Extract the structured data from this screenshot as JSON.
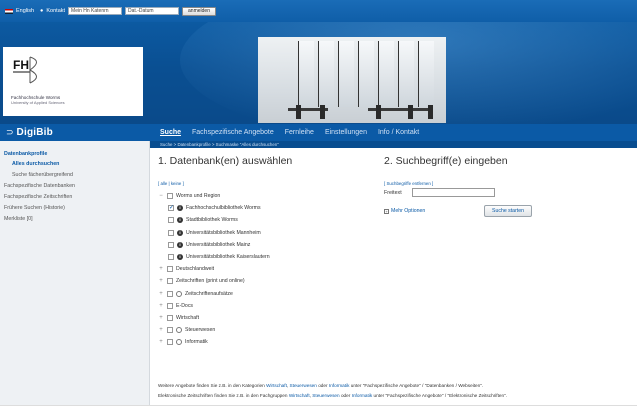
{
  "topbar": {
    "lang_label": "English",
    "contact_label": "Kontakt",
    "input1_value": "Mein Hn Katenrn",
    "input2_value": "Dat.-Datum",
    "button_label": "anmelden"
  },
  "logo": {
    "line1": "Fachhochschule Worms",
    "line2": "University of Applied Sciences"
  },
  "app": {
    "title": "DigiBib"
  },
  "nav": {
    "items": [
      "Suche",
      "Fachspezifische Angebote",
      "Fernleihe",
      "Einstellungen",
      "Info / Kontakt"
    ],
    "active_index": 0
  },
  "breadcrumb": "Suche > Datenbankprofile > Suchmaske \"Alles durchsuchen\"",
  "sidebar": {
    "items": [
      {
        "label": "Datenbankprofile",
        "type": "head"
      },
      {
        "label": "Alles durchsuchen",
        "type": "sub-selected"
      },
      {
        "label": "Suche fächerübergreifend",
        "type": "sub"
      },
      {
        "label": "Fachspezifische Datenbanken",
        "type": "item"
      },
      {
        "label": "Fachspezifische Zeitschriften",
        "type": "item"
      },
      {
        "label": "Frühere Suchen (Historie)",
        "type": "item"
      },
      {
        "label": "Merkliste [0]",
        "type": "item"
      }
    ]
  },
  "section1": {
    "title": "1. Datenbank(en) auswählen",
    "select_links": "[ alle | keine ]",
    "tree": [
      {
        "label": "Worms und Region",
        "level": 0,
        "expander": "−",
        "checked": false,
        "info": "none"
      },
      {
        "label": "Fachhochschulbibliothek Worms",
        "level": 1,
        "checked": true,
        "info": "i"
      },
      {
        "label": "Stadtbibliothek Worms",
        "level": 1,
        "checked": false,
        "info": "i"
      },
      {
        "label": "Universitätsbibliothek Mannheim",
        "level": 1,
        "checked": false,
        "info": "i"
      },
      {
        "label": "Universitätsbibliothek Mainz",
        "level": 1,
        "checked": false,
        "info": "i"
      },
      {
        "label": "Universitätsbibliothek Kaiserslautern",
        "level": 1,
        "checked": false,
        "info": "i"
      },
      {
        "label": "Deutschlandweit",
        "level": 0,
        "expander": "+",
        "checked": false,
        "info": "none"
      },
      {
        "label": "Zeitschriften (print und online)",
        "level": 0,
        "expander": "+",
        "checked": false,
        "info": "none"
      },
      {
        "label": "Zeitschriftenaufsätze",
        "level": 0,
        "expander": "+",
        "checked": false,
        "info": "grey"
      },
      {
        "label": "E-Docs",
        "level": 0,
        "expander": "+",
        "checked": false,
        "info": "none"
      },
      {
        "label": "Wirtschaft",
        "level": 0,
        "expander": "+",
        "checked": false,
        "info": "none"
      },
      {
        "label": "Steuerwesen",
        "level": 0,
        "expander": "+",
        "checked": false,
        "info": "grey"
      },
      {
        "label": "Informatik",
        "level": 0,
        "expander": "+",
        "checked": false,
        "info": "grey"
      }
    ]
  },
  "section2": {
    "title": "2. Suchbegriff(e) eingeben",
    "clear_link": "[ Suchbegriffe entfernen ]",
    "field_label": "Freitext",
    "field_value": "",
    "more_options": "Mehr Optionen",
    "submit": "Suche starten"
  },
  "footer": {
    "line1": {
      "a": "Weitere Angebote finden Sie z.B. in den Kategorien ",
      "l1": "Wirtschaft",
      "b": ", ",
      "l2": "Steuerwesen",
      "c": " oder ",
      "l3": "Informatik",
      "d": " unter \"Fachspezifische Angebote\" / \"Datenbanken / Webseiten\"."
    },
    "line2": {
      "a": "Elektronische Zeitschriften finden Sie z.B. in den Fachgruppen ",
      "l1": "Wirtschaft",
      "b": ", ",
      "l2": "Steuerwesen",
      "c": " oder ",
      "l3": "Informatik",
      "d": " unter \"Fachspezifische Angebote\" / \"Elektronische Zeitschriften\"."
    }
  },
  "colors": {
    "brand": "#0b5aa6",
    "sidebar_bg": "#eef1f4"
  }
}
